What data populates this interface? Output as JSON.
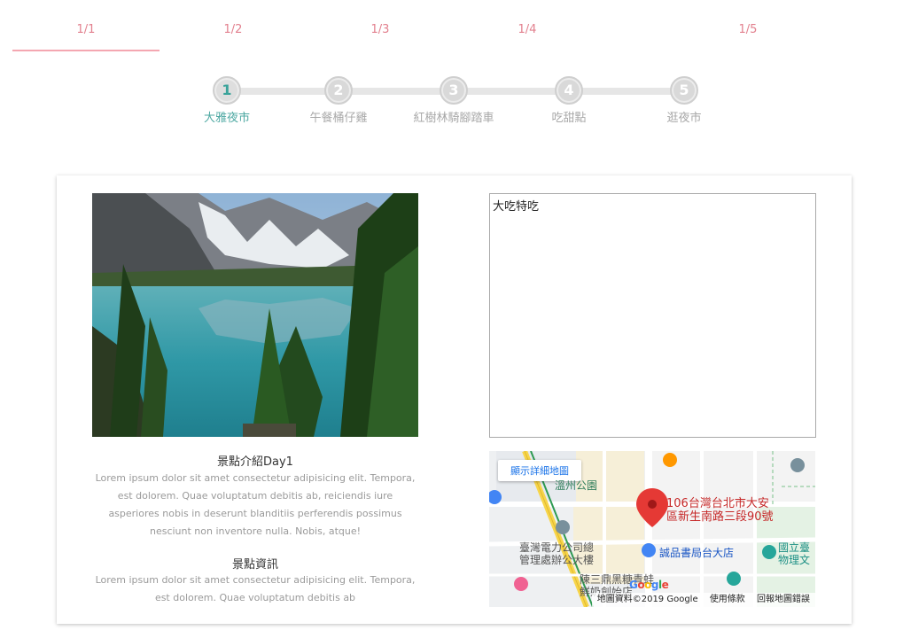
{
  "tabs": [
    {
      "label": "1/1",
      "active": true
    },
    {
      "label": "1/2",
      "active": false
    },
    {
      "label": "1/3",
      "active": false
    },
    {
      "label": "1/4",
      "active": false
    },
    {
      "label": "1/5",
      "active": false
    }
  ],
  "steps": [
    {
      "number": "1",
      "label": "大雅夜市",
      "active": true
    },
    {
      "number": "2",
      "label": "午餐桶仔雞",
      "active": false
    },
    {
      "number": "3",
      "label": "紅樹林騎腳踏車",
      "active": false
    },
    {
      "number": "4",
      "label": "吃甜點",
      "active": false
    },
    {
      "number": "5",
      "label": "逛夜市",
      "active": false
    }
  ],
  "intro": {
    "title": "景點介紹Day1",
    "body": "Lorem ipsum dolor sit amet consectetur adipisicing elit. Tempora, est dolorem. Quae voluptatum debitis ab, reiciendis iure asperiores nobis in deserunt blanditiis perferendis possimus nesciunt non inventore nulla. Nobis, atque!"
  },
  "info": {
    "title": "景點資訊",
    "body": "Lorem ipsum dolor sit amet consectetur adipisicing elit. Tempora, est dolorem. Quae voluptatum debitis ab"
  },
  "notes": {
    "value": "大吃特吃"
  },
  "map": {
    "detail_button": "顯示詳細地圖",
    "pin_address": "106台灣台北市大安\n區新生南路三段90號",
    "labels": {
      "park": "溫州公園",
      "taipower": "臺灣電力公司總\n管理處辦公大樓",
      "eslite": "誠品書局台大店",
      "university": "國立臺\n物理文",
      "chen": "陳三鼎黑糖青蛙\n鮮奶創始店"
    },
    "footer": {
      "data": "地圖資料©2019 Google",
      "terms": "使用條款",
      "report": "回報地圖錯誤"
    },
    "logo": "Google"
  },
  "colors": {
    "accent_pink": "#e2808e",
    "tab_underline": "#f4a7b1",
    "step_active": "#3aa39a",
    "pin_red": "#e53935"
  }
}
